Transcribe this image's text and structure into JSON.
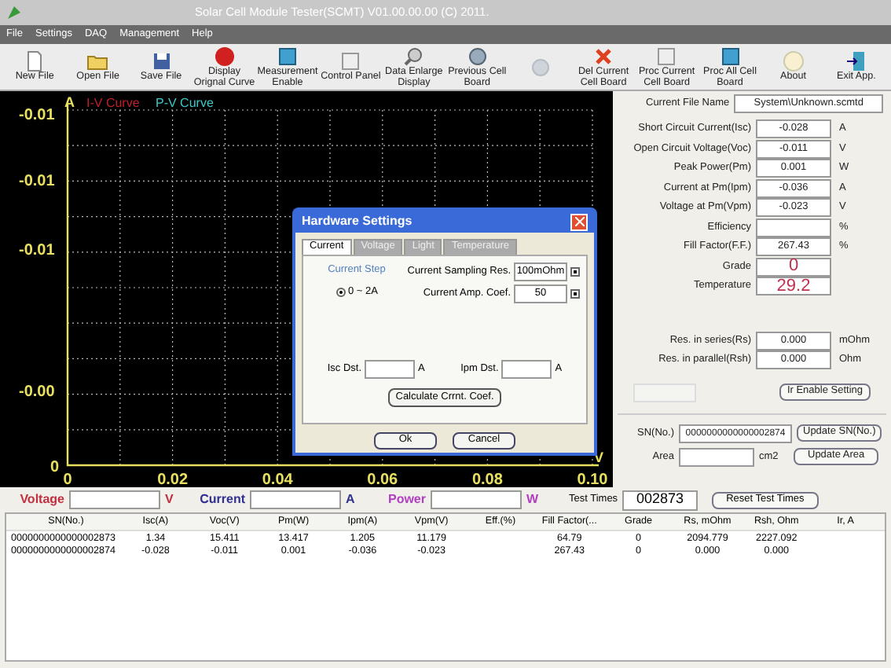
{
  "window": {
    "title": "Solar Cell Module Tester(SCMT) V01.00.00.00 (C) 2011."
  },
  "menu": [
    "File",
    "Settings",
    "DAQ",
    "Management",
    "Help"
  ],
  "toolbar": [
    {
      "label": "New File",
      "kind": "page",
      "disabled": false
    },
    {
      "label": "Open File",
      "kind": "folder",
      "disabled": false
    },
    {
      "label": "Save File",
      "kind": "disk",
      "disabled": false
    },
    {
      "label": "Display Orignal Curve",
      "kind": "record",
      "disabled": false
    },
    {
      "label": "Measurement Enable",
      "kind": "window",
      "disabled": false
    },
    {
      "label": "Control Panel",
      "kind": "panel",
      "disabled": false
    },
    {
      "label": "Data Enlarge Display",
      "kind": "magnifier",
      "disabled": false
    },
    {
      "label": "Previous Cell Board",
      "kind": "circle",
      "disabled": false
    },
    {
      "kind": "circle",
      "disabled": true
    },
    {
      "label": "Del Current Cell Board",
      "kind": "cross",
      "disabled": false
    },
    {
      "label": "Proc Current Cell Board",
      "kind": "panel",
      "disabled": false
    },
    {
      "label": "Proc All Cell Board",
      "kind": "window",
      "disabled": false
    },
    {
      "label": "About",
      "kind": "info",
      "disabled": false
    },
    {
      "label": "Exit App.",
      "kind": "exit",
      "disabled": false
    }
  ],
  "plot": {
    "y_unit": "A",
    "x_unit": "V",
    "legend": [
      {
        "name": "I-V Curve",
        "color": "#c0202a"
      },
      {
        "name": "P-V Curve",
        "color": "#40c8c8"
      }
    ],
    "yticks": [
      "-0.01",
      "-0.01",
      "-0.01",
      "-0.00",
      "0"
    ],
    "xticks": [
      "0",
      "0.02",
      "0.04",
      "0.06",
      "0.08",
      "0.10"
    ]
  },
  "dialog": {
    "title": "Hardware Settings",
    "tabs": [
      {
        "label": "Current",
        "selected": true
      },
      {
        "label": "Voltage",
        "selected": false
      },
      {
        "label": "Light",
        "selected": false
      },
      {
        "label": "Temperature",
        "selected": false
      }
    ],
    "current_step": {
      "label": "Current Step",
      "option": "0 ~ 2A",
      "checked": true
    },
    "sampling_res": {
      "label": "Current Sampling Res.",
      "value": "100mOhm"
    },
    "amp_coef": {
      "label": "Current Amp. Coef.",
      "value": "50"
    },
    "isc_dst": {
      "label": "Isc Dst.",
      "unit": "A"
    },
    "ipm_dst": {
      "label": "Ipm Dst.",
      "unit": "A"
    },
    "calculate_button": "Calculate Crrnt. Coef.",
    "buttons": [
      "Ok",
      "Cancel"
    ]
  },
  "file_name": {
    "label": "Current File Name",
    "value": "System\\Unknown.scmtd"
  },
  "measurements": [
    {
      "label": "Short Circuit Current(Isc)",
      "value": "-0.028",
      "unit": "A",
      "kind": "plain"
    },
    {
      "label": "Open Circuit Voltage(Voc)",
      "value": "-0.011",
      "unit": "V",
      "kind": "plain"
    },
    {
      "label": "Peak Power(Pm)",
      "value": "0.001",
      "unit": "W",
      "kind": "plain"
    },
    {
      "label": "Current at Pm(Ipm)",
      "value": "-0.036",
      "unit": "A",
      "kind": "plain"
    },
    {
      "label": "Voltage at Pm(Vpm)",
      "value": "-0.023",
      "unit": "V",
      "kind": "plain"
    },
    {
      "label": "Efficiency",
      "unit": "%",
      "kind": "plain"
    },
    {
      "label": "Fill Factor(F.F.)",
      "value": "267.43",
      "unit": "%",
      "kind": "plain"
    },
    {
      "label": "Grade",
      "value": "0",
      "kind": "large"
    },
    {
      "label": "Temperature",
      "value": "29.2",
      "kind": "large"
    }
  ],
  "resistances": [
    {
      "label": "Res. in series(Rs)",
      "value": "0.000",
      "unit": "mOhm"
    },
    {
      "label": "Res. in parallel(Rsh)",
      "value": "0.000",
      "unit": "Ohm"
    }
  ],
  "ir_button": "Ir Enable Setting",
  "sn": {
    "label": "SN(No.)",
    "value": "0000000000000002874",
    "button": "Update SN(No.)"
  },
  "area": {
    "label": "Area",
    "unit": "cm2",
    "button": "Update Area"
  },
  "readings": [
    {
      "label": "Voltage",
      "unit": "V",
      "color": "#c03040"
    },
    {
      "label": "Current",
      "unit": "A",
      "color": "#303090"
    },
    {
      "label": "Power",
      "unit": "W",
      "color": "#b040c0"
    }
  ],
  "test_times": {
    "label": "Test Times",
    "value": "002873",
    "button": "Reset Test Times"
  },
  "table": {
    "columns": [
      "SN(No.)",
      "Isc(A)",
      "Voc(V)",
      "Pm(W)",
      "Ipm(A)",
      "Vpm(V)",
      "Eff.(%)",
      "Fill Factor(...",
      "Grade",
      "Rs, mOhm",
      "Rsh, Ohm",
      "Ir, A"
    ],
    "rows": [
      [
        "0000000000000002873",
        "1.34",
        "15.411",
        "13.417",
        "1.205",
        "11.179",
        "",
        "64.79",
        "0",
        "2094.779",
        "2227.092",
        ""
      ],
      [
        "0000000000000002874",
        "-0.028",
        "-0.011",
        "0.001",
        "-0.036",
        "-0.023",
        "",
        "267.43",
        "0",
        "0.000",
        "0.000",
        ""
      ]
    ]
  }
}
